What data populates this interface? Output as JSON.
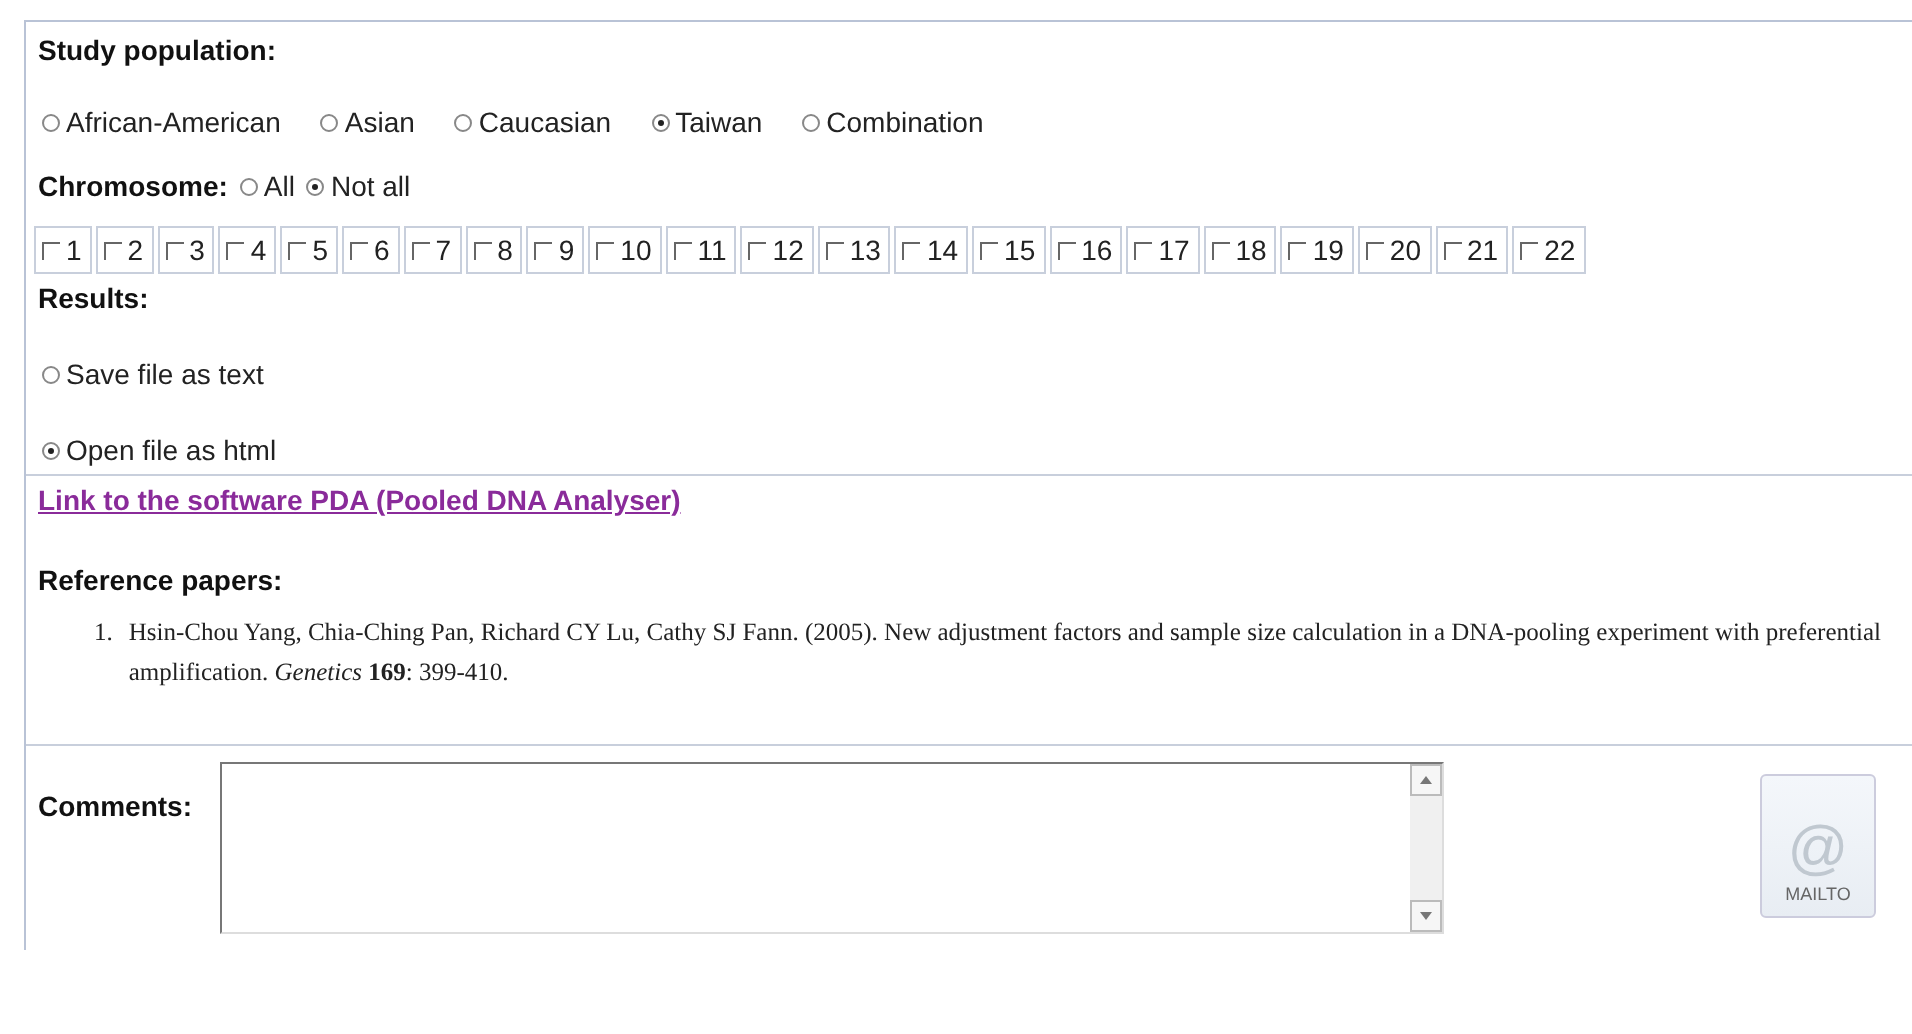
{
  "study_population": {
    "label": "Study population:",
    "options": [
      {
        "label": "African-American",
        "selected": false
      },
      {
        "label": "Asian",
        "selected": false
      },
      {
        "label": "Caucasian",
        "selected": false
      },
      {
        "label": "Taiwan",
        "selected": true
      },
      {
        "label": "Combination",
        "selected": false
      }
    ]
  },
  "chromosome": {
    "label": "Chromosome:",
    "options": [
      {
        "label": "All",
        "selected": false
      },
      {
        "label": "Not all",
        "selected": true
      }
    ],
    "boxes": [
      {
        "label": "1",
        "checked": false
      },
      {
        "label": "2",
        "checked": false
      },
      {
        "label": "3",
        "checked": false
      },
      {
        "label": "4",
        "checked": false
      },
      {
        "label": "5",
        "checked": false
      },
      {
        "label": "6",
        "checked": false
      },
      {
        "label": "7",
        "checked": false
      },
      {
        "label": "8",
        "checked": false
      },
      {
        "label": "9",
        "checked": false
      },
      {
        "label": "10",
        "checked": false
      },
      {
        "label": "11",
        "checked": false
      },
      {
        "label": "12",
        "checked": false
      },
      {
        "label": "13",
        "checked": false
      },
      {
        "label": "14",
        "checked": false
      },
      {
        "label": "15",
        "checked": false
      },
      {
        "label": "16",
        "checked": false
      },
      {
        "label": "17",
        "checked": false
      },
      {
        "label": "18",
        "checked": false
      },
      {
        "label": "19",
        "checked": false
      },
      {
        "label": "20",
        "checked": false
      },
      {
        "label": "21",
        "checked": false
      },
      {
        "label": "22",
        "checked": false
      }
    ]
  },
  "results": {
    "label": "Results:",
    "options": [
      {
        "label": "Save file as text",
        "selected": false
      },
      {
        "label": "Open file as html",
        "selected": true
      }
    ]
  },
  "link": "Link to the software PDA (Pooled DNA Analyser)",
  "references": {
    "label": "Reference papers:",
    "items": [
      {
        "number": "1.",
        "text": "Hsin-Chou Yang, Chia-Ching Pan, Richard CY Lu, Cathy SJ Fann. (2005). New adjustment factors and sample size calculation in a DNA-pooling experiment with preferential amplification. *Genetics* **169**: 399-410."
      }
    ]
  },
  "comments": {
    "label": "Comments:"
  },
  "mailto": {
    "symbol": "@",
    "label": "MAILTO"
  }
}
